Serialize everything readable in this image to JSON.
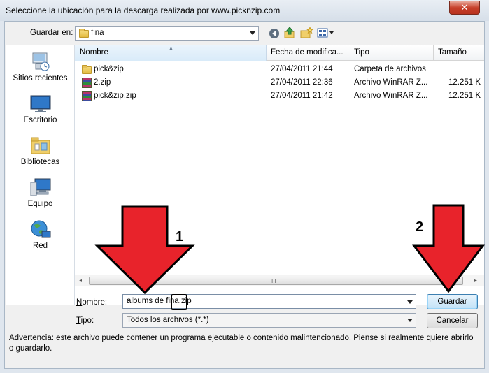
{
  "window": {
    "title": "Seleccione la ubicación para la descarga realizada por www.picknzip.com",
    "close_label": "✕"
  },
  "location": {
    "label_pre": "Guardar ",
    "label_u": "e",
    "label_post": "n:",
    "value": "fina",
    "toolbar_icons": [
      "back-icon",
      "up-folder-icon",
      "new-folder-icon",
      "view-menu-icon"
    ]
  },
  "sidebar": {
    "items": [
      {
        "label": "Sitios recientes",
        "icon": "recent-places-icon"
      },
      {
        "label": "Escritorio",
        "icon": "desktop-icon"
      },
      {
        "label": "Bibliotecas",
        "icon": "libraries-icon"
      },
      {
        "label": "Equipo",
        "icon": "computer-icon"
      },
      {
        "label": "Red",
        "icon": "network-icon"
      }
    ]
  },
  "columns": [
    "Nombre",
    "Fecha de modifica...",
    "Tipo",
    "Tamaño"
  ],
  "files": [
    {
      "name": "pick&zip",
      "date": "27/04/2011 21:44",
      "type": "Carpeta de archivos",
      "size": "",
      "icon": "folder-icon"
    },
    {
      "name": "2.zip",
      "date": "27/04/2011 22:36",
      "type": "Archivo WinRAR Z...",
      "size": "12.251 K",
      "icon": "winrar-archive-icon"
    },
    {
      "name": "pick&zip.zip",
      "date": "27/04/2011 21:42",
      "type": "Archivo WinRAR Z...",
      "size": "12.251 K",
      "icon": "winrar-archive-icon"
    }
  ],
  "scrollbar": {
    "grip": "III",
    "left": "◂",
    "right": "▸"
  },
  "filename": {
    "label_u": "N",
    "label_post": "ombre:",
    "value": "albums de fina.zip"
  },
  "filetype": {
    "label_u": "T",
    "label_post": "ipo:",
    "value": "Todos los archivos (*.*)"
  },
  "buttons": {
    "save_u": "G",
    "save_post": "uardar",
    "cancel": "Cancelar"
  },
  "warning": "Advertencia: este archivo puede contener un programa ejecutable o contenido malintencionado. Piense si realmente quiere abrirlo o guardarlo.",
  "annotations": [
    {
      "number": "1",
      "color": "#e8232b"
    },
    {
      "number": "2",
      "color": "#e8232b"
    }
  ]
}
